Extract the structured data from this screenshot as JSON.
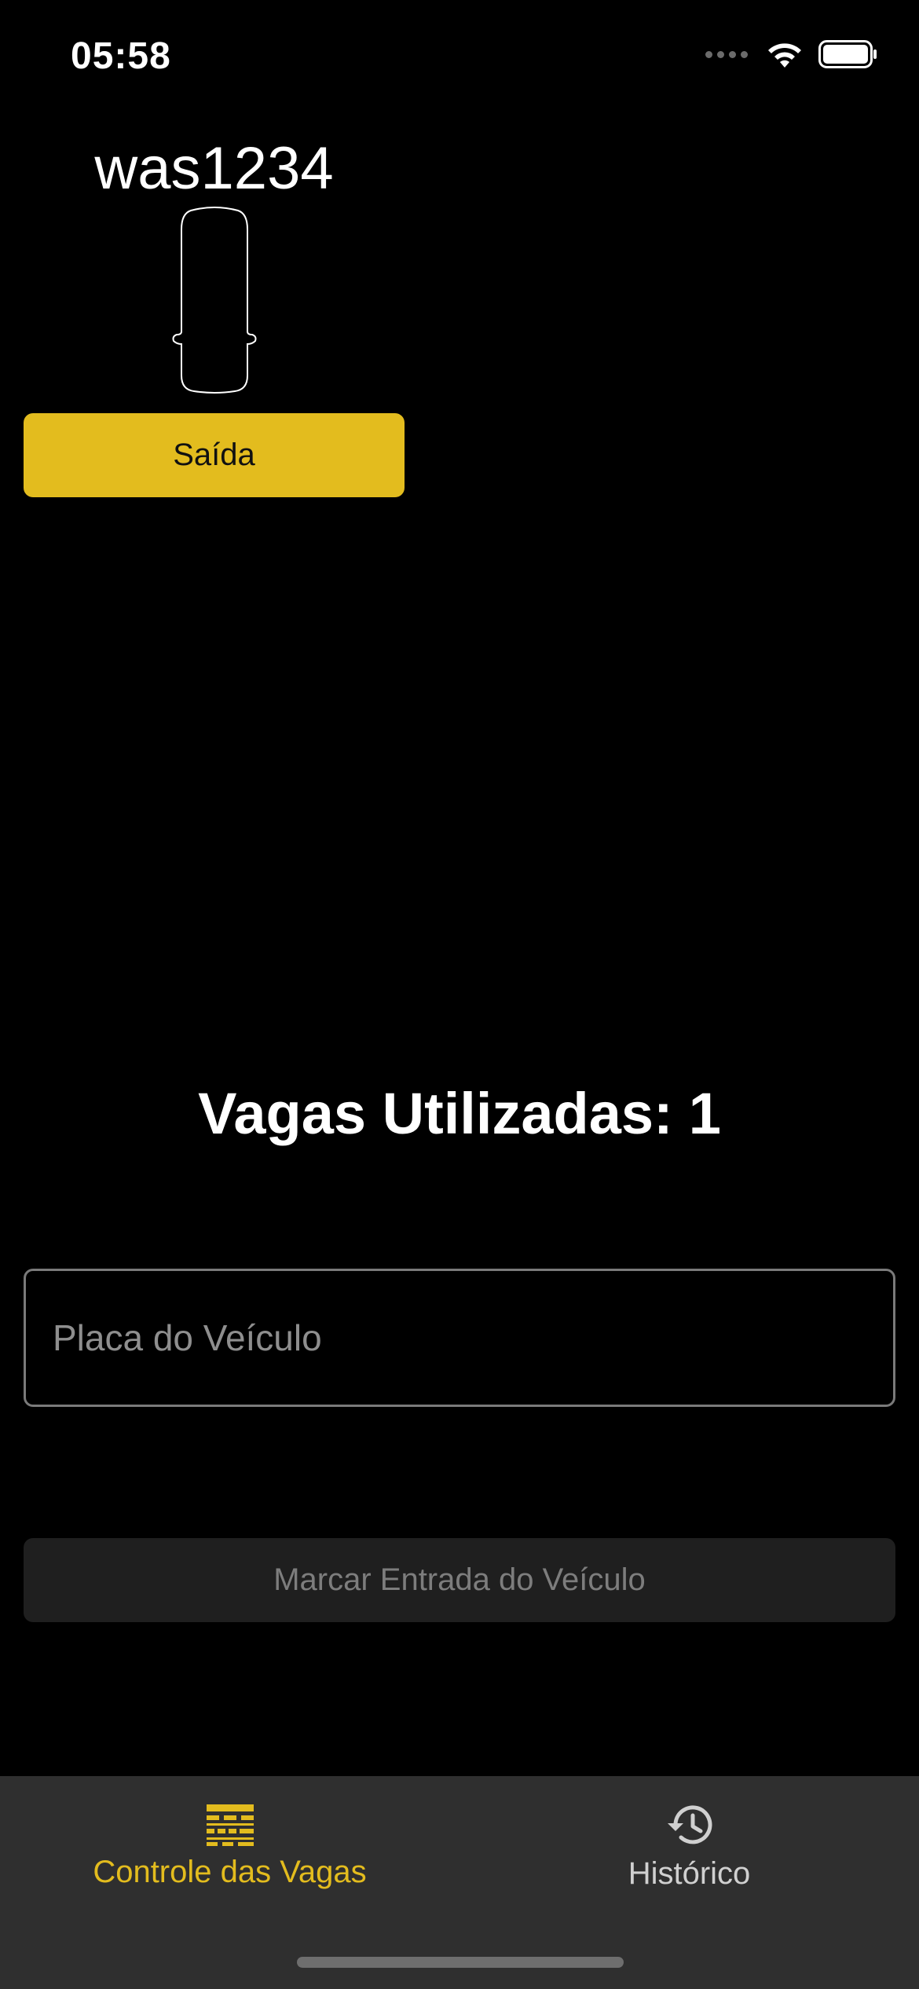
{
  "status_bar": {
    "time": "05:58"
  },
  "parked_car": {
    "plate": "was1234",
    "exit_label": "Saída"
  },
  "used_spots": {
    "label": "Vagas Utilizadas:",
    "count": "1"
  },
  "plate_input": {
    "placeholder": "Placa do Veículo",
    "value": ""
  },
  "entry_button": {
    "label": "Marcar Entrada do Veículo",
    "enabled": false
  },
  "tab_bar": {
    "tabs": [
      {
        "label": "Controle das Vagas",
        "icon": "parking-grid-icon",
        "active": true
      },
      {
        "label": "Histórico",
        "icon": "history-icon",
        "active": false
      }
    ]
  },
  "colors": {
    "accent": "#e3bc1e",
    "background": "#000000",
    "tab_bar": "#2f2f2f",
    "disabled_button": "#1f1f1f"
  }
}
